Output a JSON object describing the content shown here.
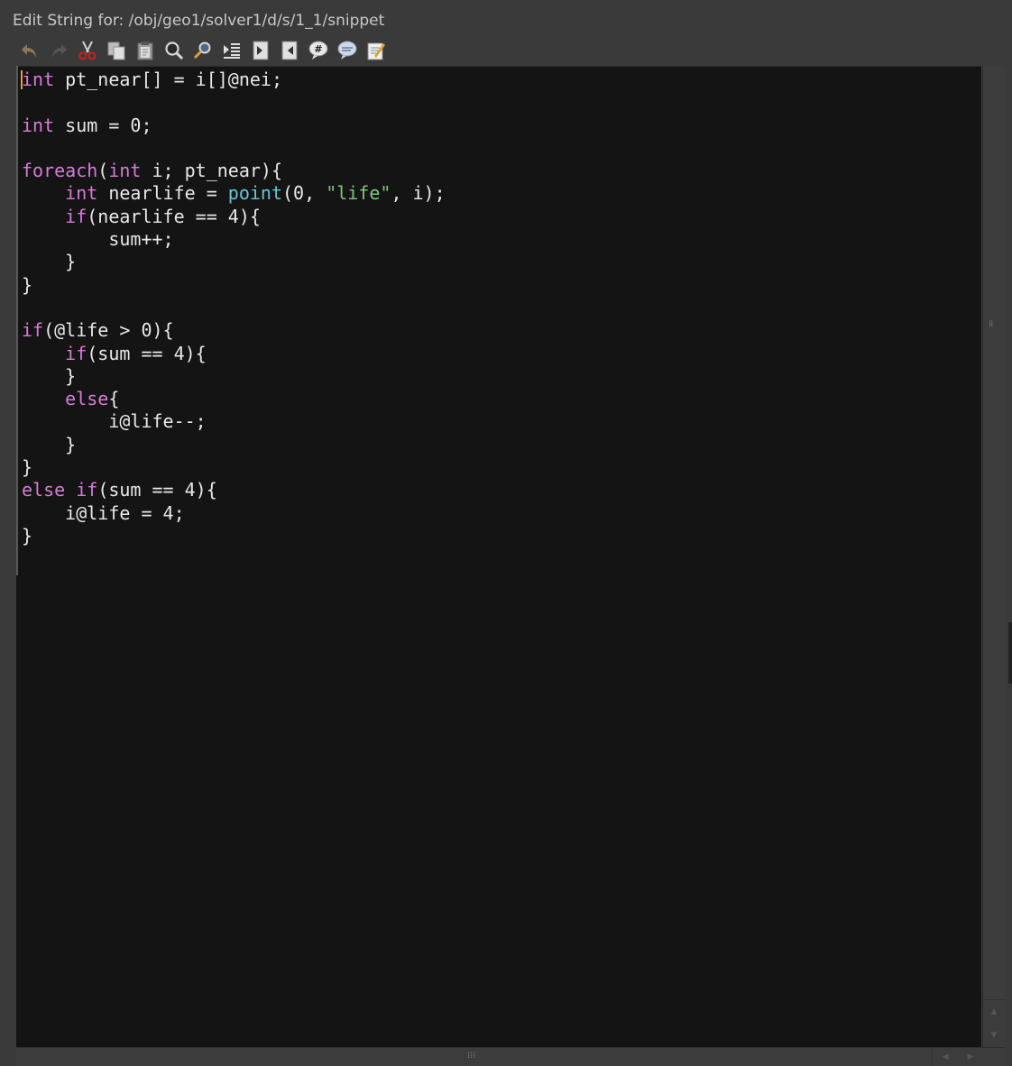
{
  "window": {
    "title": "Edit String for: /obj/geo1/solver1/d/s/1_1/snippet"
  },
  "toolbar": {
    "buttons": [
      {
        "name": "undo-icon"
      },
      {
        "name": "redo-icon"
      },
      {
        "name": "cut-icon"
      },
      {
        "name": "copy-icon"
      },
      {
        "name": "paste-icon"
      },
      {
        "name": "find-icon"
      },
      {
        "name": "find-replace-icon"
      },
      {
        "name": "indent-icon"
      },
      {
        "name": "goto-line-icon"
      },
      {
        "name": "goto-icon"
      },
      {
        "name": "comment-icon"
      },
      {
        "name": "uncomment-icon"
      },
      {
        "name": "external-editor-icon"
      }
    ]
  },
  "editor": {
    "language": "VEX",
    "colors": {
      "background": "#141414",
      "text": "#e8e8e8",
      "keyword": "#d67bd6",
      "function": "#64c6d6",
      "string": "#7ec77a",
      "caret": "#e0a030"
    },
    "lines": [
      [
        {
          "t": "int",
          "c": "kw"
        },
        {
          "t": " pt_near[] = i[]@nei;"
        }
      ],
      [],
      [
        {
          "t": "int",
          "c": "kw"
        },
        {
          "t": " sum = 0;"
        }
      ],
      [],
      [
        {
          "t": "foreach",
          "c": "kw"
        },
        {
          "t": "("
        },
        {
          "t": "int",
          "c": "kw"
        },
        {
          "t": " i; pt_near){"
        }
      ],
      [
        {
          "t": "    "
        },
        {
          "t": "int",
          "c": "kw"
        },
        {
          "t": " nearlife = "
        },
        {
          "t": "point",
          "c": "fn"
        },
        {
          "t": "(0, "
        },
        {
          "t": "\"life\"",
          "c": "str"
        },
        {
          "t": ", i);"
        }
      ],
      [
        {
          "t": "    "
        },
        {
          "t": "if",
          "c": "kw"
        },
        {
          "t": "(nearlife == 4){"
        }
      ],
      [
        {
          "t": "        sum++;"
        }
      ],
      [
        {
          "t": "    }"
        }
      ],
      [
        {
          "t": "}"
        }
      ],
      [],
      [
        {
          "t": "if",
          "c": "kw"
        },
        {
          "t": "(@life > 0){"
        }
      ],
      [
        {
          "t": "    "
        },
        {
          "t": "if",
          "c": "kw"
        },
        {
          "t": "(sum == 4){"
        }
      ],
      [
        {
          "t": "    }"
        }
      ],
      [
        {
          "t": "    "
        },
        {
          "t": "else",
          "c": "kw"
        },
        {
          "t": "{"
        }
      ],
      [
        {
          "t": "        i@life--;"
        }
      ],
      [
        {
          "t": "    }"
        }
      ],
      [
        {
          "t": "}"
        }
      ],
      [
        {
          "t": "else",
          "c": "kw"
        },
        {
          "t": " "
        },
        {
          "t": "if",
          "c": "kw"
        },
        {
          "t": "(sum == 4){"
        }
      ],
      [
        {
          "t": "    i@life = 4;"
        }
      ],
      [
        {
          "t": "}"
        }
      ]
    ]
  }
}
